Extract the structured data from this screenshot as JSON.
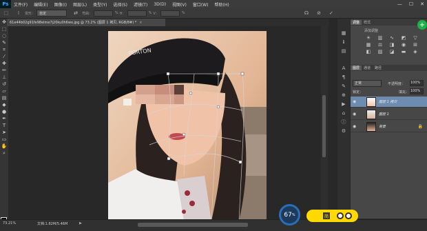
{
  "app": {
    "logo": "Ps"
  },
  "menu": [
    "文件(F)",
    "编辑(E)",
    "图像(I)",
    "图层(L)",
    "类型(Y)",
    "选择(S)",
    "滤镜(T)",
    "3D(D)",
    "视图(V)",
    "窗口(W)",
    "帮助(H)"
  ],
  "window_controls": {
    "minimize": "—",
    "maximize": "☐",
    "close": "✕"
  },
  "options": {
    "mode_label": "变形：",
    "mode_value": "自定",
    "field_labels": [
      "弯曲：",
      "%",
      "H：",
      "%",
      "V：",
      "%"
    ]
  },
  "document_tab": {
    "title": "61e44b02g91fe98elme7j20ku0h6wo.jpg @ 73.2% (图层 1 拷贝, RGB/8#) *",
    "close": "×"
  },
  "panels": {
    "top_tabs": [
      "调整",
      "样式"
    ],
    "adjust_title": "添加调整",
    "layers_tabs": [
      "图层",
      "通道",
      "路径"
    ],
    "blend_mode": "正常",
    "opacity_label": "不透明度：",
    "opacity_value": "100%",
    "lock_label": "锁定：",
    "fill_label": "填充：",
    "fill_value": "100%",
    "layers": [
      {
        "name": "图层 1 拷贝",
        "selected": true
      },
      {
        "name": "图层 1",
        "selected": false
      },
      {
        "name": "背景",
        "selected": false,
        "locked": true
      }
    ]
  },
  "status": {
    "zoom": "73.21%",
    "doc": "文档:1.82M/5.46M"
  },
  "widget": {
    "percent": "67",
    "unit": "%",
    "pill_text": "简"
  },
  "photo_text": {
    "cap_text": "PORTON"
  }
}
